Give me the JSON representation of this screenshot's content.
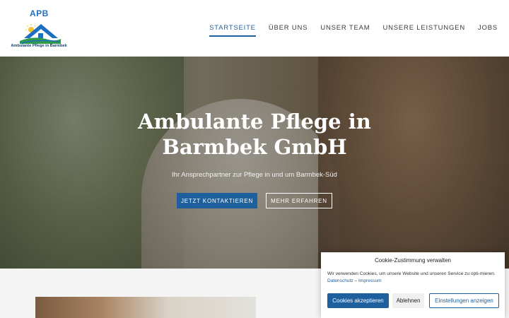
{
  "logo": {
    "abbr": "APB",
    "name": "Ambulante Pflege in Barmbek"
  },
  "nav": {
    "items": [
      {
        "label": "STARTSEITE",
        "active": true
      },
      {
        "label": "ÜBER UNS",
        "active": false
      },
      {
        "label": "UNSER TEAM",
        "active": false
      },
      {
        "label": "UNSERE LEISTUNGEN",
        "active": false
      },
      {
        "label": "JOBS",
        "active": false
      }
    ]
  },
  "hero": {
    "title_line1": "Ambulante Pflege in",
    "title_line2": "Barmbek GmbH",
    "subtitle": "Ihr Ansprechpartner zur Pflege in und um Barmbek-Süd",
    "primary_button": "JETZT KONTAKTIEREN",
    "secondary_button": "MEHR ERFAHREN"
  },
  "cookie": {
    "title": "Cookie-Zustimmung verwalten",
    "text": "Wir verwenden Cookies, um unsere Website und unseren Service zu opti-mieren.",
    "link_privacy": "Datenschutz",
    "separator": "–",
    "link_imprint": "Impressum",
    "accept_label": "Cookies akzeptieren",
    "deny_label": "Ablehnen",
    "settings_label": "Einstellungen anzeigen"
  },
  "colors": {
    "accent": "#1e5f9e",
    "logo_blue": "#1e6fbf"
  }
}
